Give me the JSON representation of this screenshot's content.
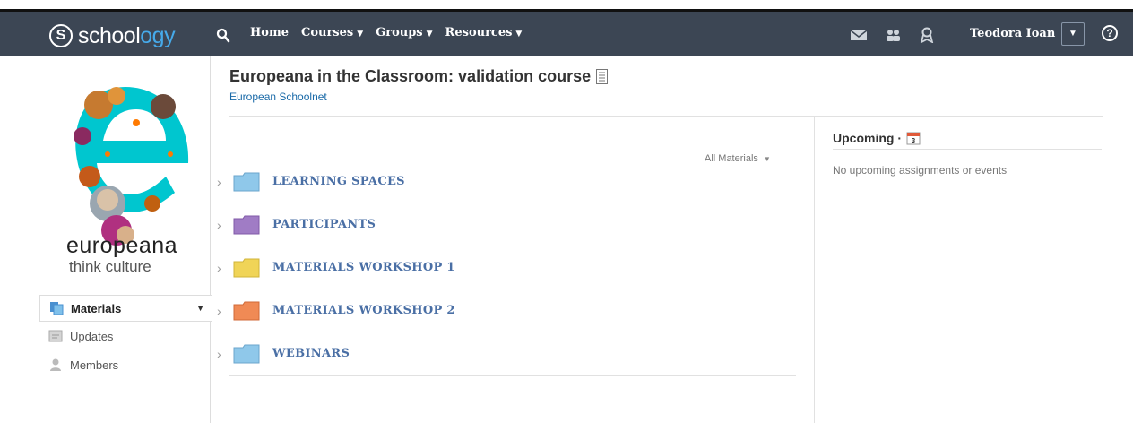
{
  "brand": {
    "s_glyph": "S",
    "text_a": "schoo",
    "text_b": "l",
    "text_c": "ogy"
  },
  "nav": [
    {
      "label": "Home",
      "dropdown": false
    },
    {
      "label": "Courses",
      "dropdown": true
    },
    {
      "label": "Groups",
      "dropdown": true
    },
    {
      "label": "Resources",
      "dropdown": true
    }
  ],
  "header": {
    "user_name": "Teodora Ioan",
    "help_glyph": "?"
  },
  "course": {
    "title": "Europeana in the Classroom: validation course",
    "org": "European Schoolnet",
    "logo_word": "europeana",
    "logo_tagline": "think culture"
  },
  "sidebar": {
    "items": [
      {
        "label": "Materials",
        "active": true
      },
      {
        "label": "Updates",
        "active": false
      },
      {
        "label": "Members",
        "active": false
      }
    ]
  },
  "materials": {
    "filter_label": "All Materials",
    "folders": [
      {
        "label": "LEARNING SPACES",
        "color": "#8fc8ea"
      },
      {
        "label": "PARTICIPANTS",
        "color": "#a07cc5"
      },
      {
        "label": "MATERIALS WORKSHOP 1",
        "color": "#f0d457"
      },
      {
        "label": "MATERIALS WORKSHOP 2",
        "color": "#f08a55"
      },
      {
        "label": "WEBINARS",
        "color": "#8fc8ea"
      }
    ]
  },
  "upcoming": {
    "title": "Upcoming ·",
    "calendar_day": "3",
    "empty_text": "No upcoming assignments or events"
  },
  "colors": {
    "topbar": "#3c4654",
    "link": "#4a6fa5",
    "accent": "#46aaea"
  }
}
